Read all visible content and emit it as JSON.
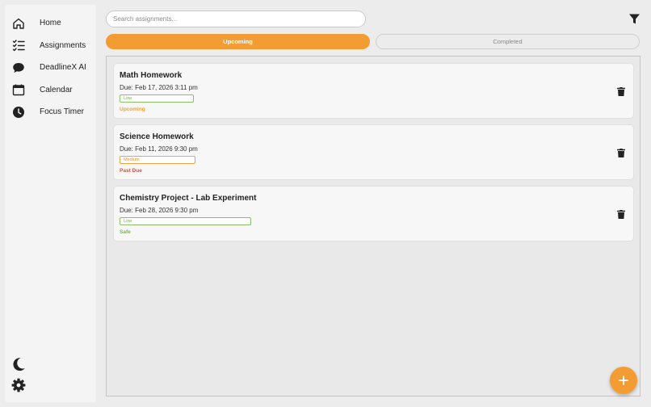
{
  "sidebar": {
    "items": [
      {
        "label": "Home",
        "icon": "home-icon"
      },
      {
        "label": "Assignments",
        "icon": "checklist-icon"
      },
      {
        "label": "DeadlineX AI",
        "icon": "chat-bubble-icon"
      },
      {
        "label": "Calendar",
        "icon": "calendar-icon"
      },
      {
        "label": "Focus Timer",
        "icon": "clock-icon"
      }
    ],
    "bottom_icons": [
      "moon-icon",
      "gear-icon"
    ]
  },
  "search": {
    "placeholder": "Search assignments..."
  },
  "tabs": {
    "upcoming": "Upcoming",
    "completed": "Completed",
    "active": "upcoming"
  },
  "assignments": [
    {
      "title": "Math Homework",
      "due": "Due: Feb 17, 2026 3:11 pm",
      "priority": "Low",
      "status": "Upcoming"
    },
    {
      "title": "Science Homework",
      "due": "Due: Feb 11, 2026 9:30 pm",
      "priority": "Medium",
      "status": "Past Due"
    },
    {
      "title": "Chemistry Project - Lab Experiment",
      "due": "Due: Feb 28, 2026 9:30 pm",
      "priority": "Low",
      "status": "Safe"
    }
  ],
  "colors": {
    "accent": "#f39c33",
    "priority_low": "#6fae4a",
    "priority_medium": "#f08f22",
    "status_upcoming": "#f0a030",
    "status_past_due": "#d0563f",
    "status_safe": "#78b358"
  },
  "icons": {
    "filter": "filter-icon",
    "delete": "trash-icon",
    "add": "plus-icon"
  }
}
